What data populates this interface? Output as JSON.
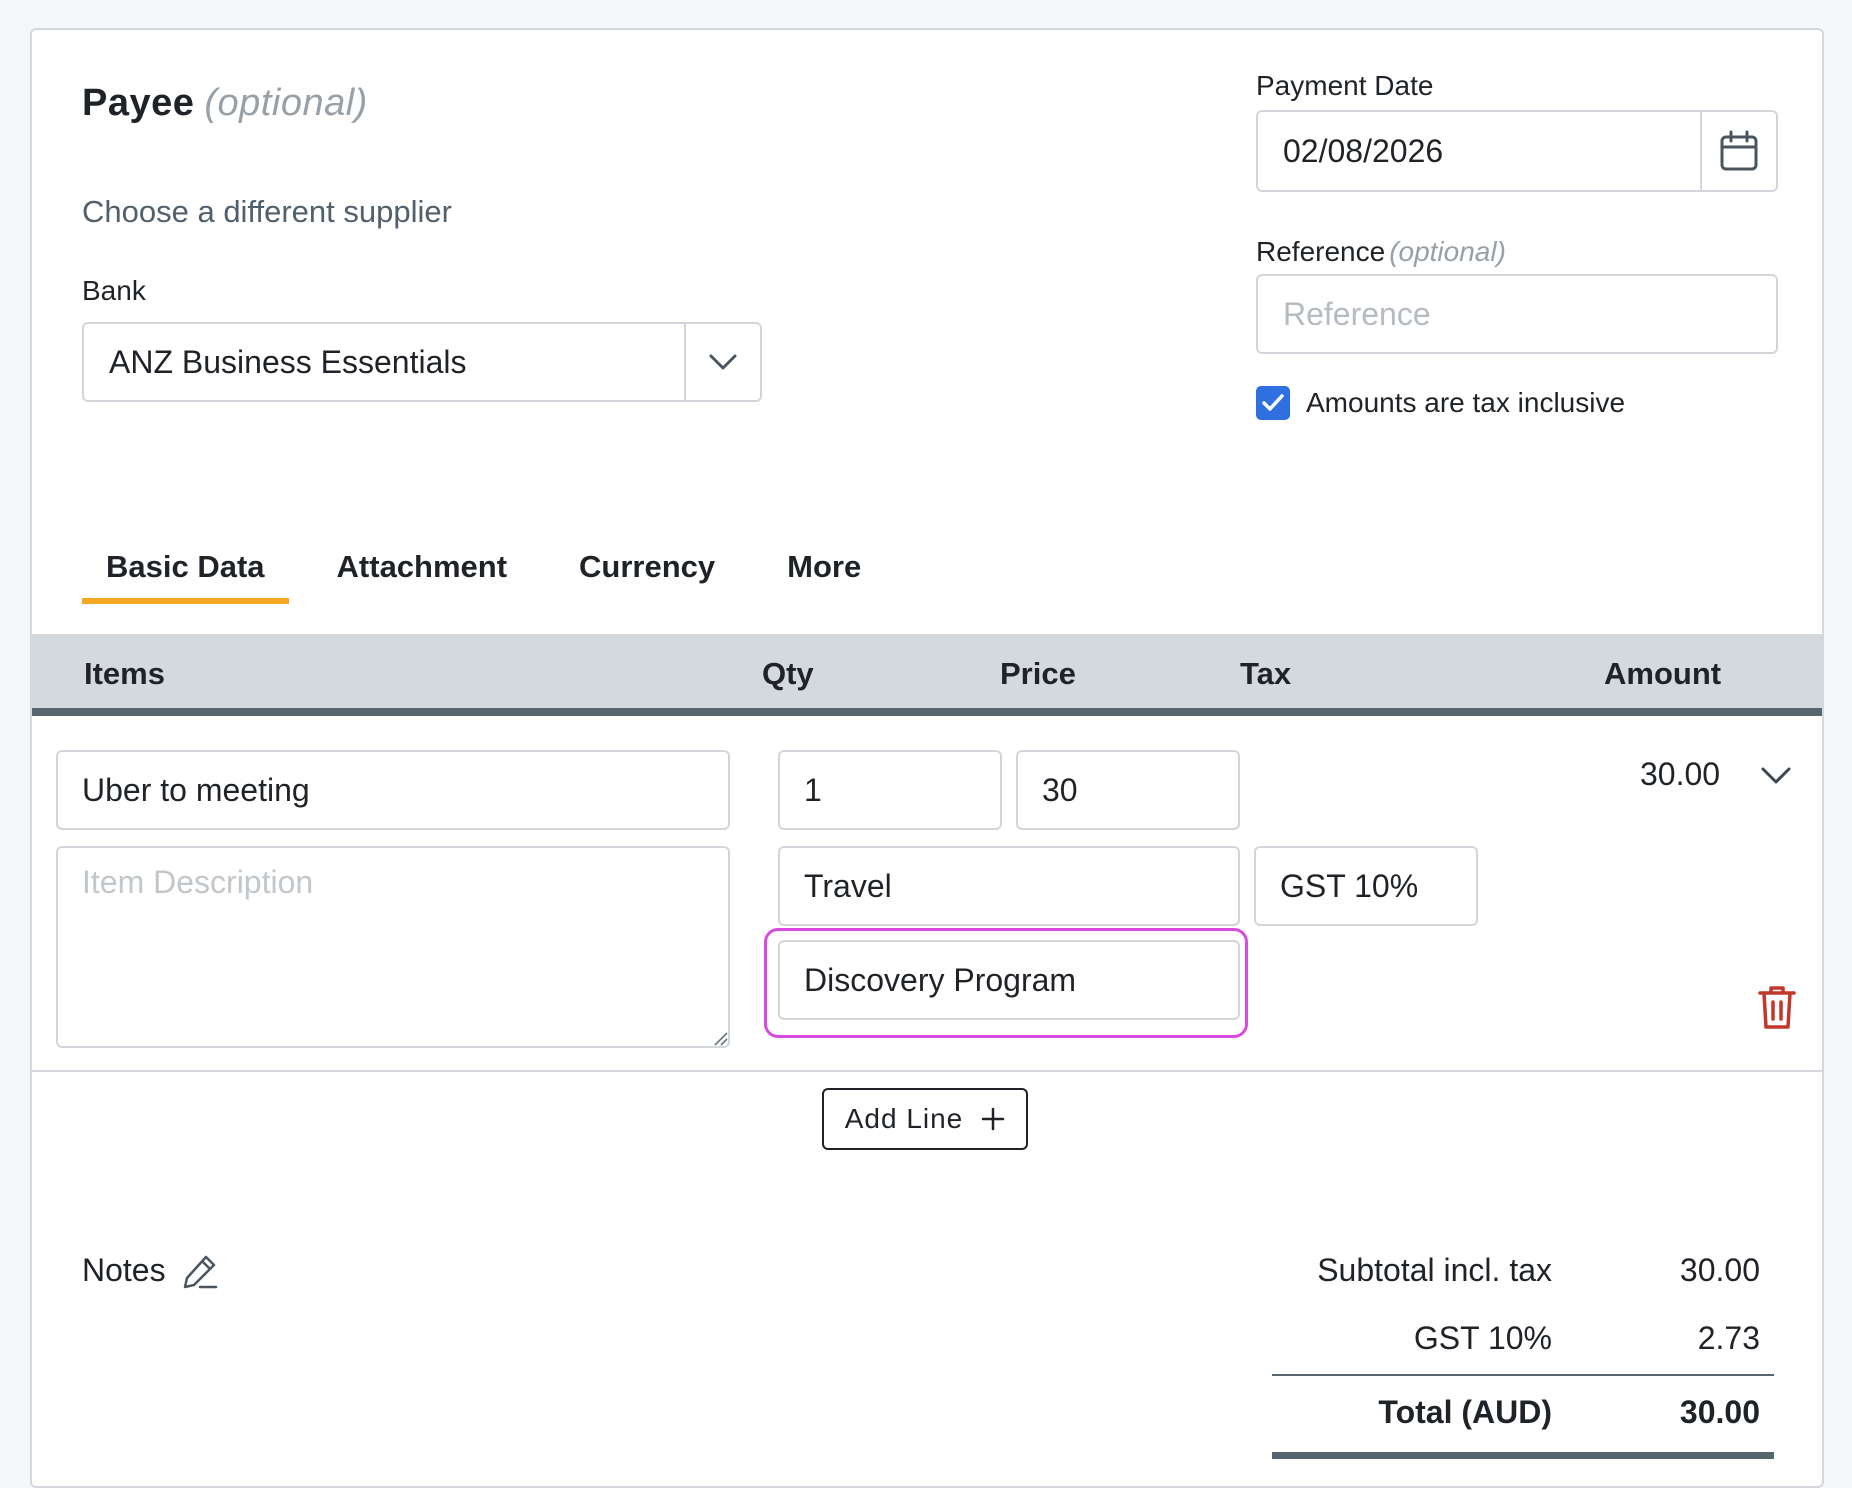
{
  "payee": {
    "title": "Payee",
    "optional": "(optional)",
    "choose_supplier": "Choose a different supplier"
  },
  "bank": {
    "label": "Bank",
    "value": "ANZ Business Essentials"
  },
  "payment_date": {
    "label": "Payment Date",
    "value": "02/08/2026"
  },
  "reference": {
    "label": "Reference",
    "optional": "(optional)",
    "placeholder": "Reference"
  },
  "tax_inclusive": {
    "label": "Amounts are tax inclusive",
    "checked": true
  },
  "tabs": [
    {
      "label": "Basic Data",
      "active": true
    },
    {
      "label": "Attachment",
      "active": false
    },
    {
      "label": "Currency",
      "active": false
    },
    {
      "label": "More",
      "active": false
    }
  ],
  "table": {
    "headers": {
      "items": "Items",
      "qty": "Qty",
      "price": "Price",
      "tax": "Tax",
      "amount": "Amount"
    }
  },
  "line": {
    "item": "Uber to meeting",
    "qty": "1",
    "price": "30",
    "description_placeholder": "Item Description",
    "account": "Travel",
    "tax_rate": "GST 10%",
    "tracking": "Discovery Program",
    "amount": "30.00"
  },
  "add_line": {
    "label": "Add Line"
  },
  "notes": {
    "label": "Notes"
  },
  "totals": {
    "subtotal_label": "Subtotal incl. tax",
    "subtotal_value": "30.00",
    "gst_label": "GST 10%",
    "gst_value": "2.73",
    "total_label": "Total (AUD)",
    "total_value": "30.00"
  },
  "colors": {
    "accent": "#f5a623",
    "checkbox": "#2f6fe0",
    "highlight": "#d94be0",
    "delete": "#c0392b",
    "header_bg": "#d3d9dd"
  }
}
